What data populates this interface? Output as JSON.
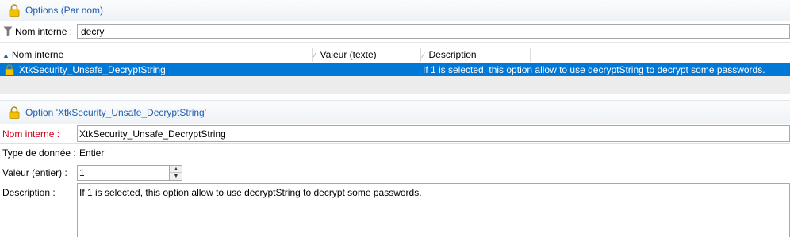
{
  "header": {
    "title": "Options (Par nom)"
  },
  "filter": {
    "label": "Nom interne :",
    "value": "decry"
  },
  "table": {
    "columns": [
      "Nom interne",
      "Valeur (texte)",
      "Description"
    ],
    "rows": [
      {
        "name": "XtkSecurity_Unsafe_DecryptString",
        "value": "",
        "description": "If 1 is selected, this option allow to use decryptString to decrypt some passwords."
      }
    ]
  },
  "option": {
    "title": "Option 'XtkSecurity_Unsafe_DecryptString'",
    "fields": {
      "name_label": "Nom interne :",
      "name_value": "XtkSecurity_Unsafe_DecryptString",
      "type_label": "Type de donnée :",
      "type_value": "Entier",
      "value_label": "Valeur (entier) :",
      "value_value": "1",
      "desc_label": "Description :",
      "desc_value": "If 1 is selected, this option allow to use decryptString to decrypt some passwords."
    }
  },
  "colors": {
    "accent": "#1f5fae",
    "selection": "#0078d7",
    "required_label": "#d0021b",
    "lock_icon": "#f2c200"
  }
}
